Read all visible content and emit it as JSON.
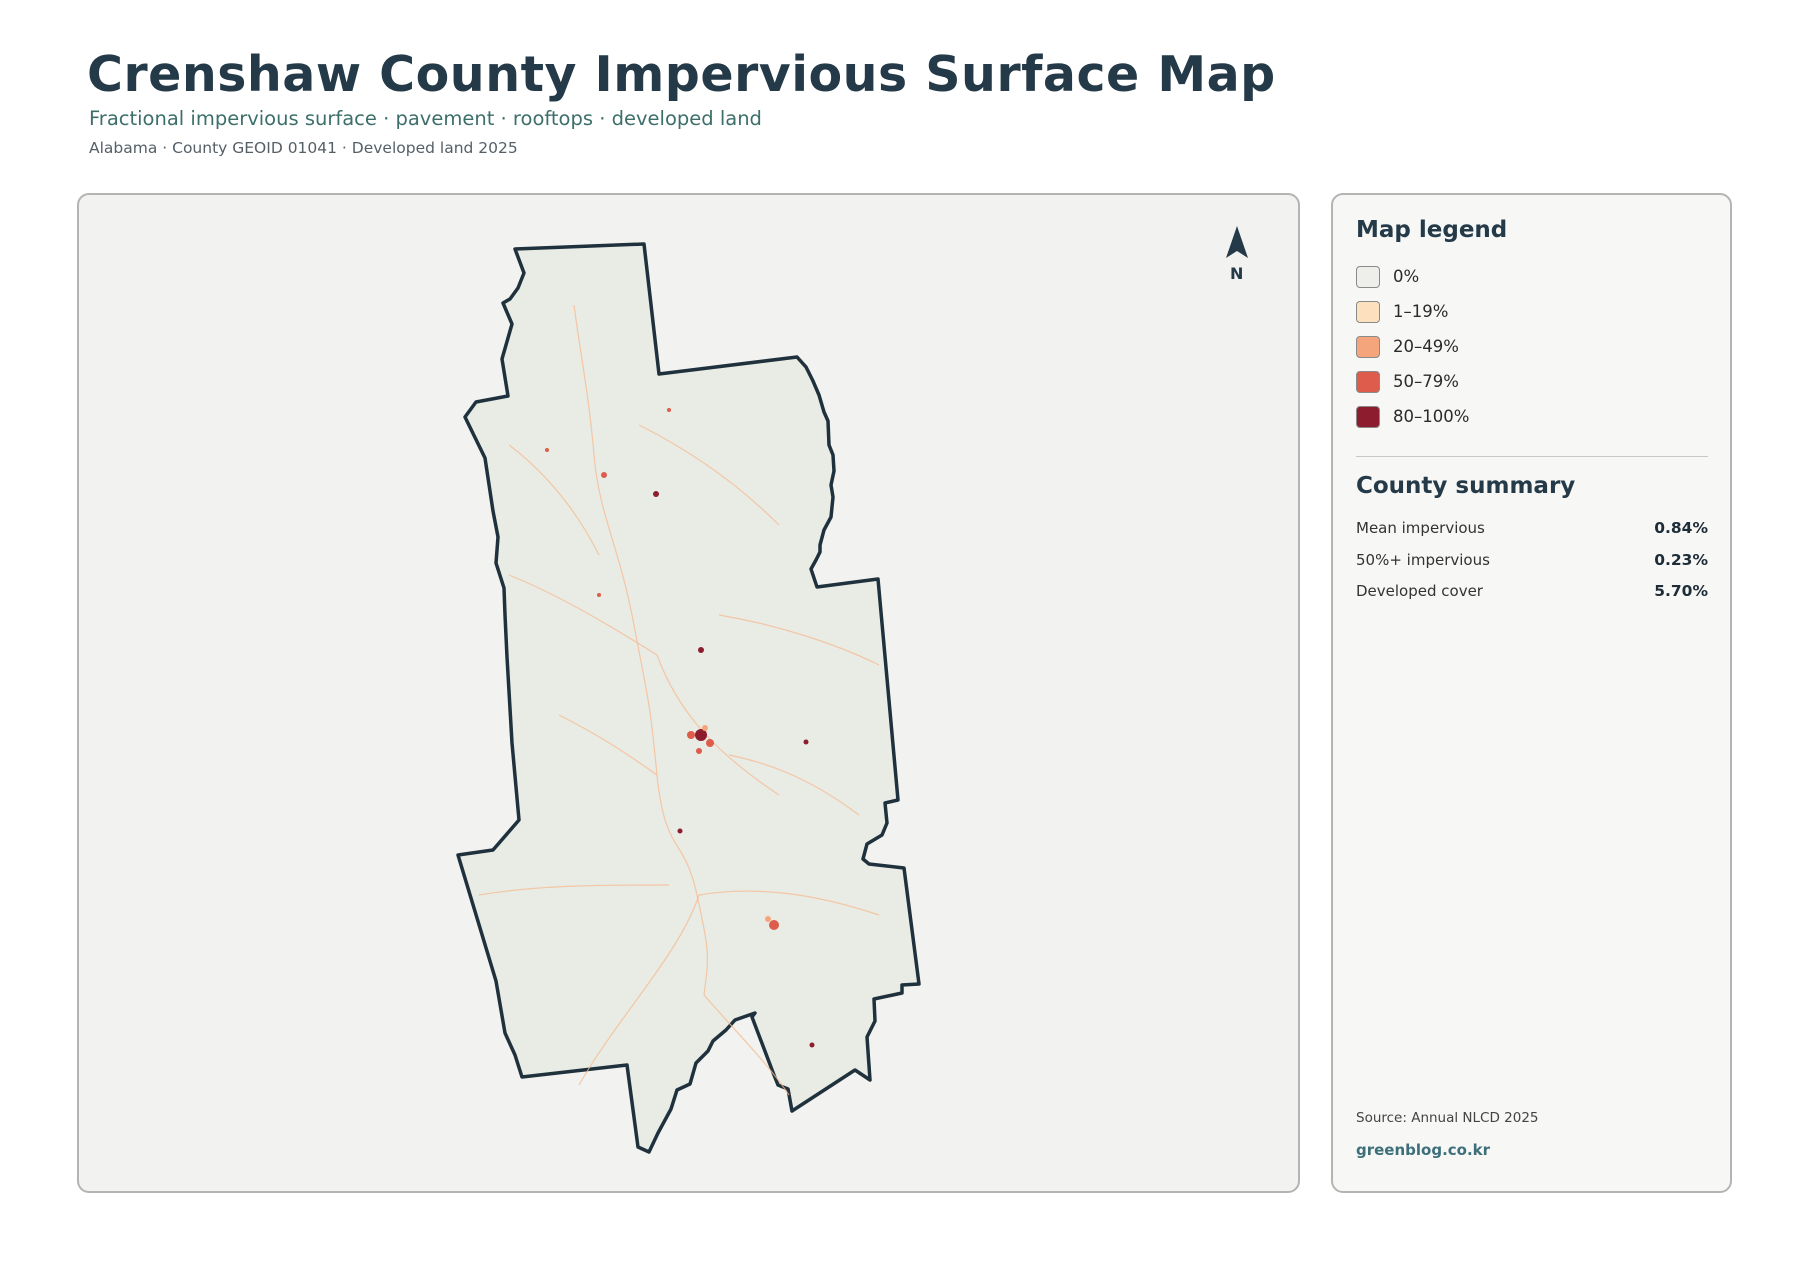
{
  "header": {
    "title": "Crenshaw County Impervious Surface Map",
    "subtitle": "Fractional impervious surface · pavement · rooftops · developed land",
    "meta": "Alabama · County GEOID 01041 · Developed land 2025"
  },
  "map": {
    "north_label": "N",
    "north_icon": "north-arrow-icon",
    "colors": {
      "county_fill": "#e9ebe5",
      "county_outline": "#1f313c",
      "background": "#f2f2f0"
    }
  },
  "legend": {
    "title": "Map legend",
    "items": [
      {
        "label": "0%",
        "color": "#eeeeea"
      },
      {
        "label": "1–19%",
        "color": "#fde0bd"
      },
      {
        "label": "20–49%",
        "color": "#f4a57c"
      },
      {
        "label": "50–79%",
        "color": "#dd5c4c"
      },
      {
        "label": "80–100%",
        "color": "#8c1c2e"
      }
    ]
  },
  "summary": {
    "title": "County summary",
    "stats": [
      {
        "label": "Mean impervious",
        "value": "0.84%"
      },
      {
        "label": "50%+ impervious",
        "value": "0.23%"
      },
      {
        "label": "Developed cover",
        "value": "5.70%"
      }
    ]
  },
  "footer": {
    "source": "Source: Annual NLCD 2025",
    "site": "greenblog.co.kr"
  }
}
